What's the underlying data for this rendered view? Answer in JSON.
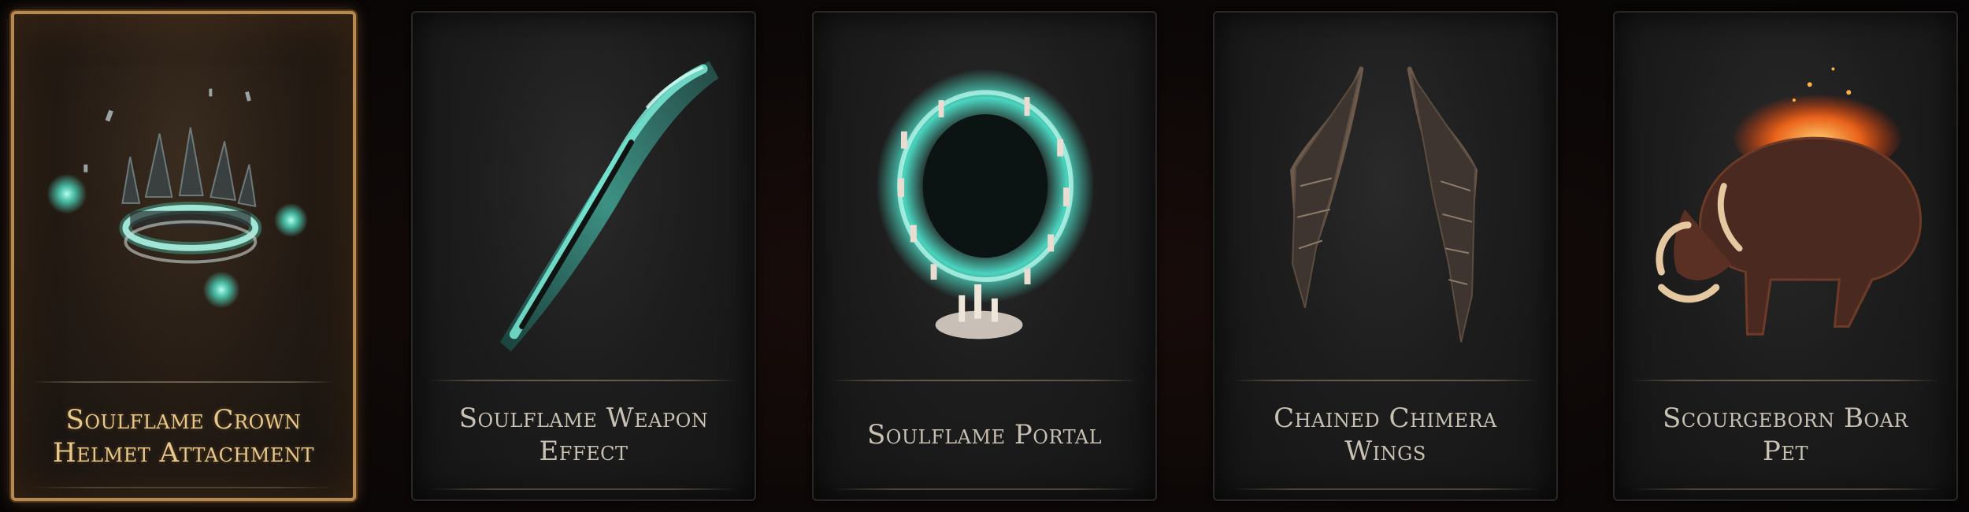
{
  "cards": [
    {
      "line1": "Soulflame Crown",
      "line2": "Helmet Attachment",
      "selected": true,
      "icon": "soulflame-crown-icon",
      "accent": "#4fe0c4"
    },
    {
      "line1": "Soulflame Weapon",
      "line2": "Effect",
      "selected": false,
      "icon": "soulflame-weapon-effect-icon",
      "accent": "#3fe0c8"
    },
    {
      "line1": "Soulflame Portal",
      "line2": "",
      "selected": false,
      "icon": "soulflame-portal-icon",
      "accent": "#45e8cf"
    },
    {
      "line1": "Chained Chimera",
      "line2": "Wings",
      "selected": false,
      "icon": "chained-chimera-wings-icon",
      "accent": "#6b5a4c"
    },
    {
      "line1": "Scourgeborn Boar",
      "line2": "Pet",
      "selected": false,
      "icon": "scourgeborn-boar-pet-icon",
      "accent": "#ff6a1a"
    }
  ],
  "colors": {
    "selected_border": "#b58a52",
    "selected_text": "#e8c98a",
    "label_text": "#c7c0b3"
  }
}
